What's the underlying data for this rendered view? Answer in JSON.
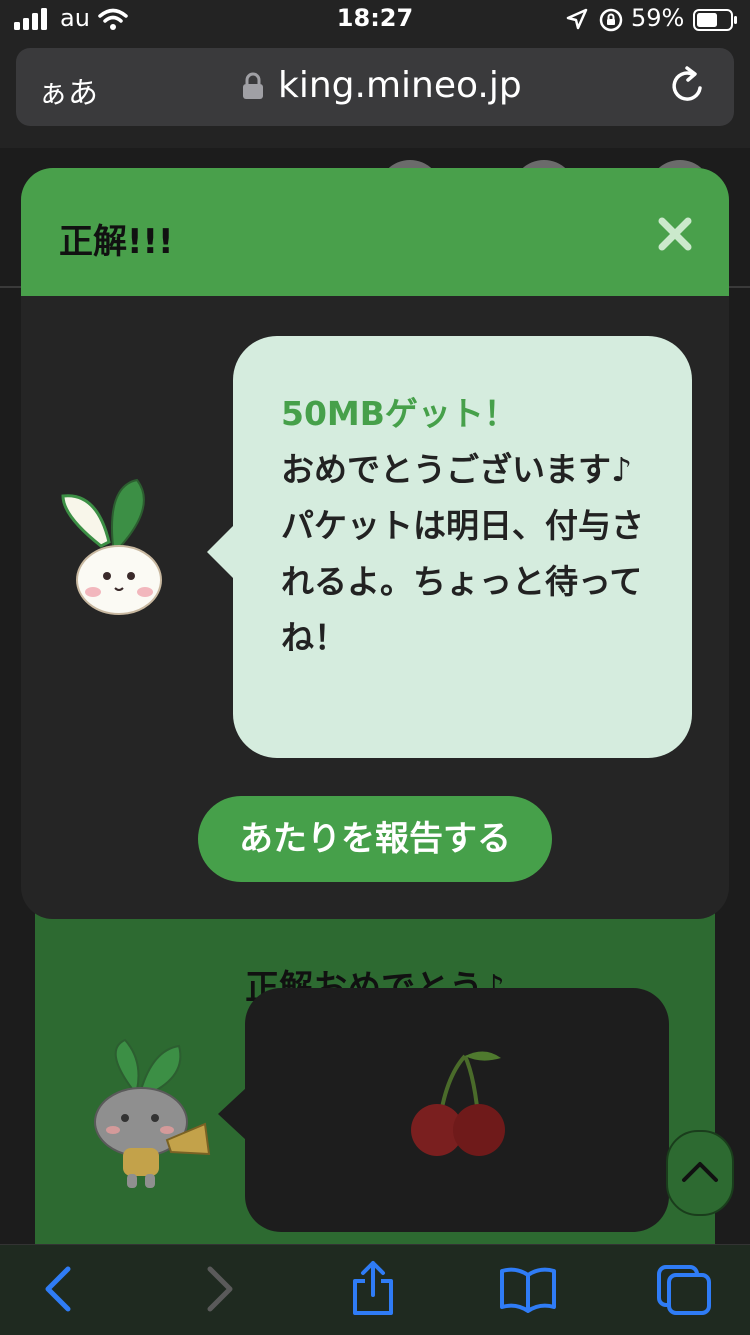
{
  "status_bar": {
    "carrier": "au",
    "time": "18:27",
    "battery_percent": "59%"
  },
  "address_bar": {
    "aa_label": "ぁあ",
    "url": "king.mineo.jp"
  },
  "background_page": {
    "heading": "正解おめでとう♪"
  },
  "modal": {
    "title": "正解!!!",
    "message_highlight": "50MBゲット！",
    "message_body": "おめでとうございます♪\nパケットは明日、付与されるよ。ちょっと待ってね！",
    "button_label": "あたりを報告する"
  },
  "colors": {
    "brand_green": "#49a04b",
    "bubble_bg": "#d5ecde",
    "ios_blue": "#2f7cf6"
  },
  "icons": {
    "close": "close-icon",
    "back": "chevron-left-icon",
    "forward": "chevron-right-icon",
    "share": "share-icon",
    "bookmarks": "book-icon",
    "tabs": "tabs-icon"
  }
}
